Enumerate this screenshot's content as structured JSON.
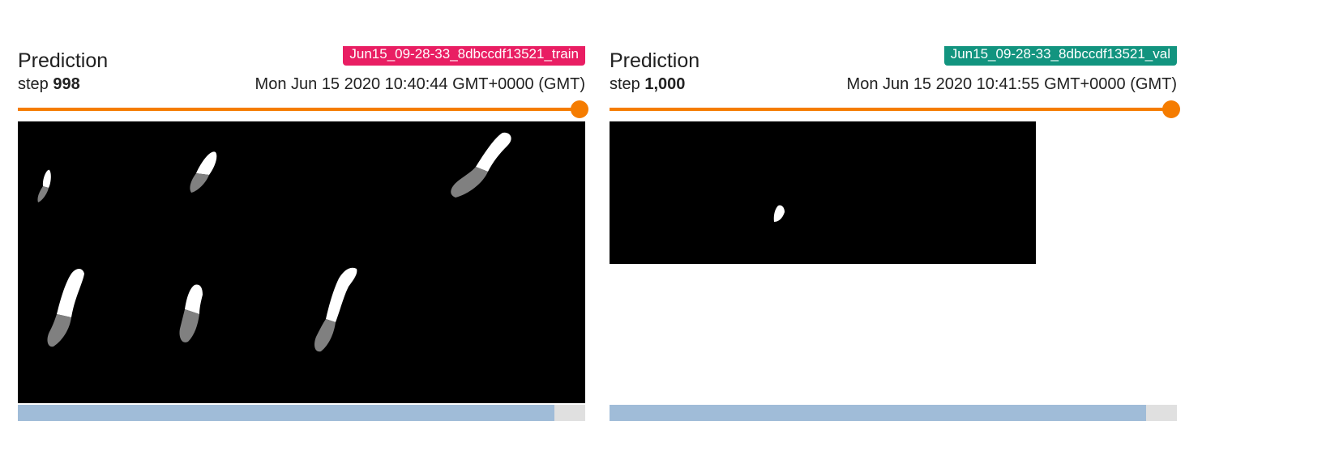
{
  "cards": [
    {
      "title": "Prediction",
      "run": "Jun15_09-28-33_8dbccdf13521_train",
      "run_color": "#e91e63",
      "step_label": "step",
      "step": "998",
      "wall_time": "Mon Jun 15 2020 10:40:44 GMT+0000 (GMT)",
      "slider_position": 1.0,
      "scroll_thumb_fraction": 0.945
    },
    {
      "title": "Prediction",
      "run": "Jun15_09-28-33_8dbccdf13521_val",
      "run_color": "#12947f",
      "step_label": "step",
      "step": "1,000",
      "wall_time": "Mon Jun 15 2020 10:41:55 GMT+0000 (GMT)",
      "slider_position": 1.0,
      "scroll_thumb_fraction": 0.945
    }
  ]
}
